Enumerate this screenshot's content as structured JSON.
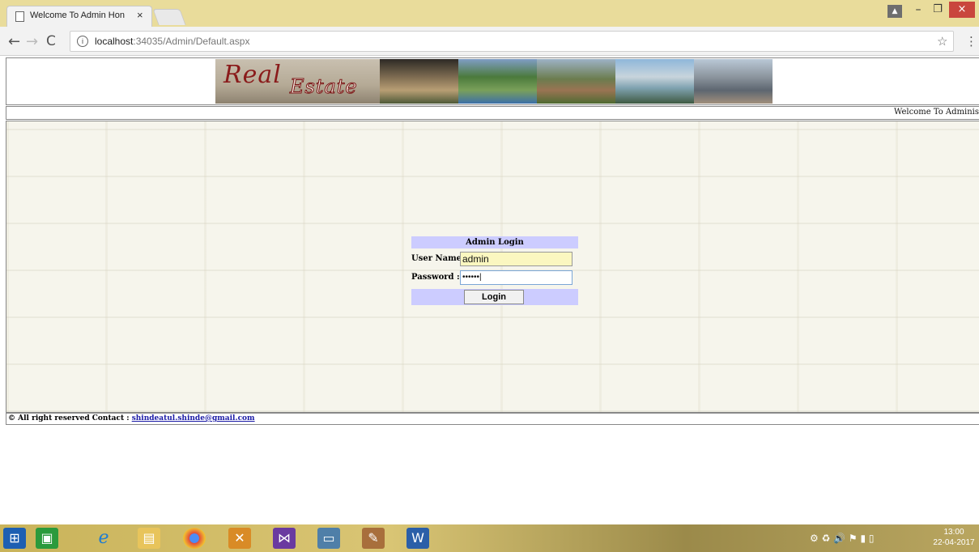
{
  "browser": {
    "tab_title": "Welcome To Admin Hon",
    "tab_close": "×",
    "url_host": "localhost",
    "url_rest": ":34035/Admin/Default.aspx",
    "info_glyph": "i",
    "icons": {
      "back": "arrow-left-icon",
      "forward": "arrow-right-icon",
      "reload": "reload-icon",
      "star": "star-icon",
      "menu": "vertical-dots-icon",
      "close": "close-icon"
    },
    "window": {
      "user": "▲",
      "minimize": "–",
      "maximize": "❐",
      "close": "×"
    }
  },
  "banner": {
    "logo_word1": "Real",
    "logo_word2": "Estate"
  },
  "welcome": {
    "text": "Welcome To Adminis"
  },
  "login": {
    "heading": "Admin Login",
    "username_label": "User Name :",
    "username_value": "admin",
    "password_label": "Password   :",
    "password_value": "••••••|",
    "button_label": "Login"
  },
  "footer": {
    "text": "© All right reserved Contact : ",
    "email": "shindeatul.shinde@gmail.com"
  },
  "taskbar": {
    "clock_time": "13:00",
    "clock_date": "22-04-2017",
    "tray_icons": "⚙ ♻ 🔊 ⚑ ▮ ▯"
  },
  "colors": {
    "titlebar": "#e9dc9b",
    "login_header_bg": "#ccccff",
    "username_bg": "#fbf7c0",
    "link": "#1a1aa6",
    "close_button": "#c9463d"
  }
}
